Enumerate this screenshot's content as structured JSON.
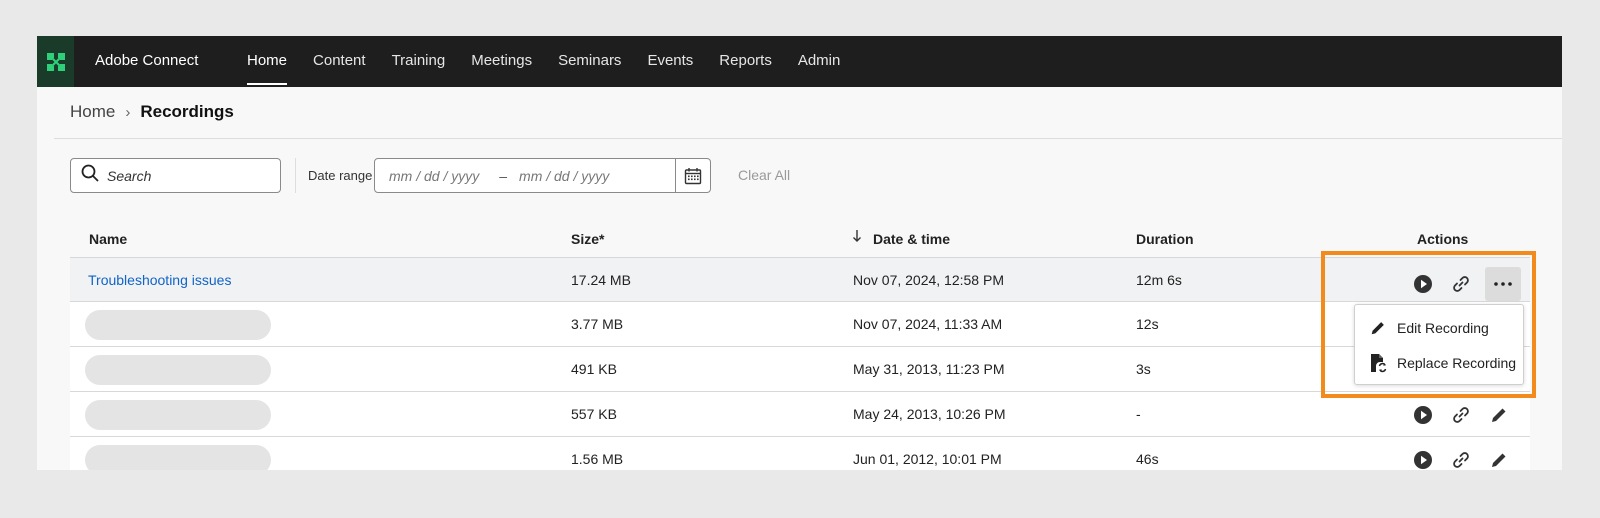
{
  "app": {
    "name": "Adobe Connect",
    "logo_icon": "adobe-connect-logo-icon"
  },
  "nav": {
    "items": [
      {
        "label": "Home",
        "active": true
      },
      {
        "label": "Content",
        "active": false
      },
      {
        "label": "Training",
        "active": false
      },
      {
        "label": "Meetings",
        "active": false
      },
      {
        "label": "Seminars",
        "active": false
      },
      {
        "label": "Events",
        "active": false
      },
      {
        "label": "Reports",
        "active": false
      },
      {
        "label": "Admin",
        "active": false
      }
    ]
  },
  "breadcrumb": {
    "home": "Home",
    "separator": "›",
    "current": "Recordings"
  },
  "filters": {
    "search_placeholder": "Search",
    "date_range_label": "Date range",
    "date_from_placeholder": "mm / dd / yyyy",
    "date_separator": "–",
    "date_to_placeholder": "mm / dd / yyyy",
    "clear_all": "Clear All"
  },
  "table": {
    "columns": {
      "name": "Name",
      "size": "Size*",
      "date": "Date & time",
      "duration": "Duration",
      "actions": "Actions"
    },
    "sort": {
      "column": "date",
      "direction": "descending",
      "icon": "arrow-down-icon"
    },
    "rows": [
      {
        "name": "Troubleshooting issues",
        "size": "17.24 MB",
        "date": "Nov 07, 2024, 12:58 PM",
        "duration": "12m 6s"
      },
      {
        "name": "",
        "size": "3.77 MB",
        "date": "Nov 07, 2024, 11:33 AM",
        "duration": "12s"
      },
      {
        "name": "",
        "size": "491 KB",
        "date": "May 31, 2013, 11:23 PM",
        "duration": "3s"
      },
      {
        "name": "",
        "size": "557 KB",
        "date": "May 24, 2013, 10:26 PM",
        "duration": "-"
      },
      {
        "name": "",
        "size": "1.56 MB",
        "date": "Jun 01, 2012, 10:01 PM",
        "duration": "46s"
      }
    ]
  },
  "action_menu": {
    "items": [
      {
        "label": "Edit Recording",
        "icon": "pencil-icon"
      },
      {
        "label": "Replace Recording",
        "icon": "replace-file-icon"
      }
    ]
  },
  "colors": {
    "topbar": "#1e1e1e",
    "link": "#1064c8",
    "highlight": "#f28a1c",
    "logo": "#2fd07a"
  }
}
